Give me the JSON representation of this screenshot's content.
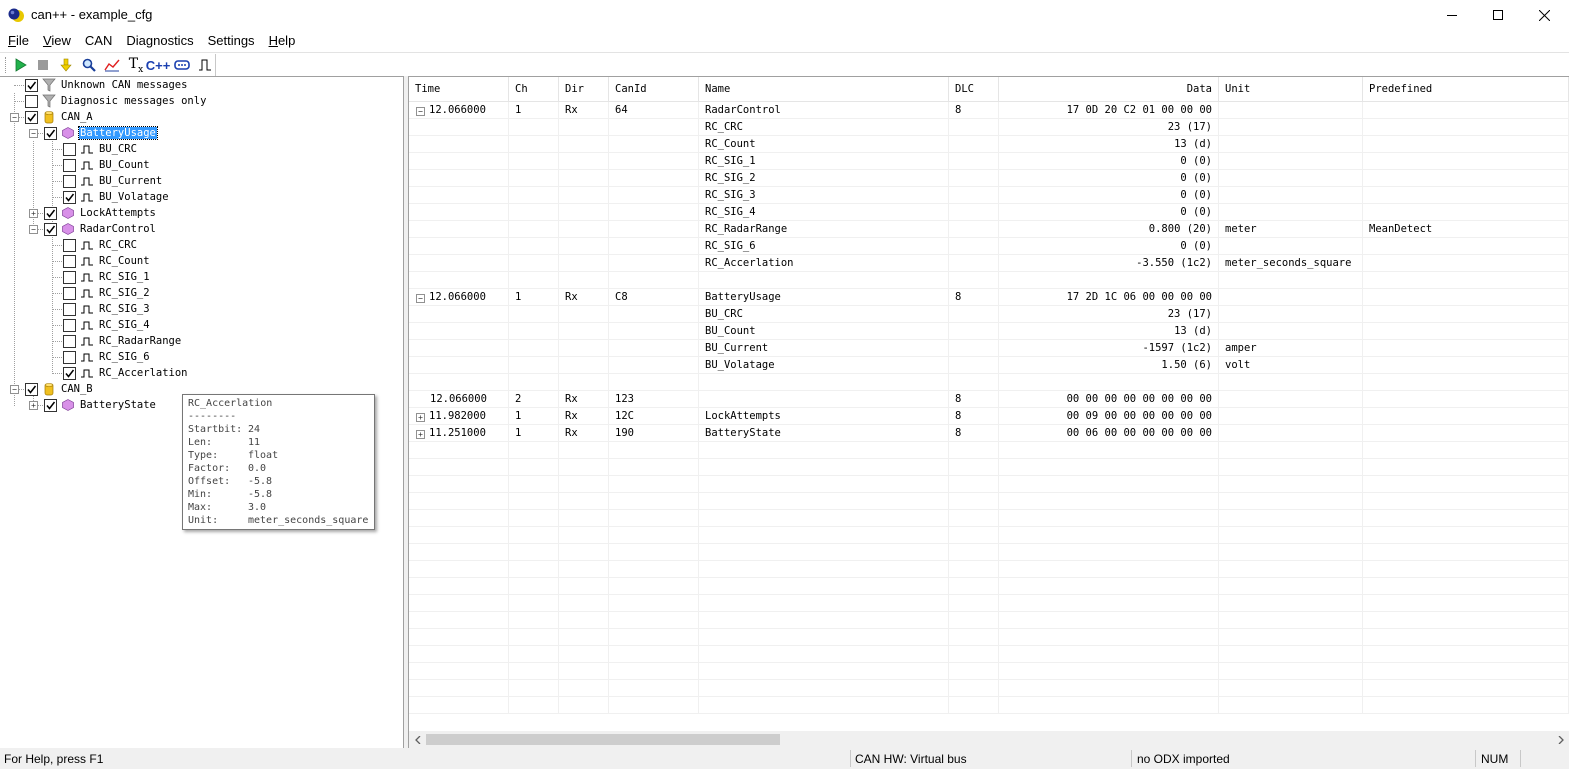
{
  "window": {
    "title": "can++ - example_cfg"
  },
  "menu": [
    {
      "label": "File",
      "acc": "F",
      "rest": "ile"
    },
    {
      "label": "View",
      "acc": "V",
      "rest": "iew"
    },
    {
      "label": "CAN",
      "acc": "",
      "rest": "CAN"
    },
    {
      "label": "Diagnostics",
      "acc": "",
      "rest": "Diagnostics"
    },
    {
      "label": "Settings",
      "acc": "",
      "rest": "Settings"
    },
    {
      "label": "Help",
      "acc": "H",
      "rest": "elp"
    }
  ],
  "toolbar": {
    "buttons": [
      "play-icon",
      "stop-icon",
      "download-icon",
      "search-icon",
      "chart-icon",
      "tx-icon",
      "cpp-icon",
      "can-interface-icon",
      "signal-icon"
    ],
    "tx_label": "T",
    "tx_sub": "x",
    "cpp_label": "C++"
  },
  "tree": {
    "unknown": "Unknown CAN messages",
    "diag": "Diagnosic messages only",
    "can_a": "CAN_A",
    "battery_usage": "BatteryUsage",
    "bu_crc": "BU_CRC",
    "bu_count": "BU_Count",
    "bu_current": "BU_Current",
    "bu_volatage": "BU_Volatage",
    "lock_attempts": "LockAttempts",
    "radar_control": "RadarControl",
    "rc_crc": "RC_CRC",
    "rc_count": "RC_Count",
    "rc_sig1": "RC_SIG_1",
    "rc_sig2": "RC_SIG_2",
    "rc_sig3": "RC_SIG_3",
    "rc_sig4": "RC_SIG_4",
    "rc_radarrange": "RC_RadarRange",
    "rc_sig6": "RC_SIG_6",
    "rc_accerlation": "RC_Accerlation",
    "can_b": "CAN_B",
    "battery_state": "BatteryState"
  },
  "tooltip": {
    "title": "RC_Accerlation",
    "sep": "--------",
    "startbit_k": "Startbit:",
    "startbit_v": "24",
    "len_k": "Len:",
    "len_v": "11",
    "type_k": "Type:",
    "type_v": "float",
    "factor_k": "Factor:",
    "factor_v": "0.0",
    "offset_k": "Offset:",
    "offset_v": "-5.8",
    "min_k": "Min:",
    "min_v": "-5.8",
    "max_k": "Max:",
    "max_v": "3.0",
    "unit_k": "Unit:",
    "unit_v": "meter_seconds_square"
  },
  "list": {
    "columns": [
      "Time",
      "Ch",
      "Dir",
      "CanId",
      "Name",
      "DLC",
      "Data",
      "Unit",
      "Predefined"
    ],
    "rows": [
      {
        "exp": "−",
        "time": "12.066000",
        "ch": "1",
        "dir": "Rx",
        "canid": "64",
        "name": "RadarControl",
        "dlc": "8",
        "data": "17 0D 20 C2 01 00 00 00",
        "unit": "",
        "pre": ""
      },
      {
        "exp": "",
        "time": "",
        "ch": "",
        "dir": "",
        "canid": "",
        "name": "RC_CRC",
        "dlc": "",
        "data": "23 (17)",
        "unit": "",
        "pre": ""
      },
      {
        "exp": "",
        "time": "",
        "ch": "",
        "dir": "",
        "canid": "",
        "name": "RC_Count",
        "dlc": "",
        "data": "13 (d)",
        "unit": "",
        "pre": ""
      },
      {
        "exp": "",
        "time": "",
        "ch": "",
        "dir": "",
        "canid": "",
        "name": "RC_SIG_1",
        "dlc": "",
        "data": "0 (0)",
        "unit": "",
        "pre": ""
      },
      {
        "exp": "",
        "time": "",
        "ch": "",
        "dir": "",
        "canid": "",
        "name": "RC_SIG_2",
        "dlc": "",
        "data": "0 (0)",
        "unit": "",
        "pre": ""
      },
      {
        "exp": "",
        "time": "",
        "ch": "",
        "dir": "",
        "canid": "",
        "name": "RC_SIG_3",
        "dlc": "",
        "data": "0 (0)",
        "unit": "",
        "pre": ""
      },
      {
        "exp": "",
        "time": "",
        "ch": "",
        "dir": "",
        "canid": "",
        "name": "RC_SIG_4",
        "dlc": "",
        "data": "0 (0)",
        "unit": "",
        "pre": ""
      },
      {
        "exp": "",
        "time": "",
        "ch": "",
        "dir": "",
        "canid": "",
        "name": "RC_RadarRange",
        "dlc": "",
        "data": "0.800 (20)",
        "unit": "meter",
        "pre": "MeanDetect"
      },
      {
        "exp": "",
        "time": "",
        "ch": "",
        "dir": "",
        "canid": "",
        "name": "RC_SIG_6",
        "dlc": "",
        "data": "0 (0)",
        "unit": "",
        "pre": ""
      },
      {
        "exp": "",
        "time": "",
        "ch": "",
        "dir": "",
        "canid": "",
        "name": "RC_Accerlation",
        "dlc": "",
        "data": "-3.550 (1c2)",
        "unit": "meter_seconds_square",
        "pre": ""
      },
      {
        "exp": "",
        "time": "",
        "ch": "",
        "dir": "",
        "canid": "",
        "name": "",
        "dlc": "",
        "data": "",
        "unit": "",
        "pre": ""
      },
      {
        "exp": "−",
        "time": "12.066000",
        "ch": "1",
        "dir": "Rx",
        "canid": "C8",
        "name": "BatteryUsage",
        "dlc": "8",
        "data": "17 2D 1C 06 00 00 00 00",
        "unit": "",
        "pre": ""
      },
      {
        "exp": "",
        "time": "",
        "ch": "",
        "dir": "",
        "canid": "",
        "name": "BU_CRC",
        "dlc": "",
        "data": "23 (17)",
        "unit": "",
        "pre": ""
      },
      {
        "exp": "",
        "time": "",
        "ch": "",
        "dir": "",
        "canid": "",
        "name": "BU_Count",
        "dlc": "",
        "data": "13 (d)",
        "unit": "",
        "pre": ""
      },
      {
        "exp": "",
        "time": "",
        "ch": "",
        "dir": "",
        "canid": "",
        "name": "BU_Current",
        "dlc": "",
        "data": "-1597 (1c2)",
        "unit": "amper",
        "pre": ""
      },
      {
        "exp": "",
        "time": "",
        "ch": "",
        "dir": "",
        "canid": "",
        "name": "BU_Volatage",
        "dlc": "",
        "data": "1.50 (6)",
        "unit": "volt",
        "pre": ""
      },
      {
        "exp": "",
        "time": "",
        "ch": "",
        "dir": "",
        "canid": "",
        "name": "",
        "dlc": "",
        "data": "",
        "unit": "",
        "pre": ""
      },
      {
        "exp": "",
        "time": "12.066000",
        "ch": "2",
        "dir": "Rx",
        "canid": "123",
        "name": "",
        "dlc": "8",
        "data": "00 00 00 00 00 00 00 00",
        "unit": "",
        "pre": ""
      },
      {
        "exp": "+",
        "time": "11.982000",
        "ch": "1",
        "dir": "Rx",
        "canid": "12C",
        "name": "LockAttempts",
        "dlc": "8",
        "data": "00 09 00 00 00 00 00 00",
        "unit": "",
        "pre": ""
      },
      {
        "exp": "+",
        "time": "11.251000",
        "ch": "1",
        "dir": "Rx",
        "canid": "190",
        "name": "BatteryState",
        "dlc": "8",
        "data": "00 06 00 00 00 00 00 00",
        "unit": "",
        "pre": ""
      }
    ]
  },
  "status": {
    "help": "For Help, press F1",
    "hw": "CAN HW: Virtual bus",
    "odx": "no ODX imported",
    "num": "NUM"
  }
}
